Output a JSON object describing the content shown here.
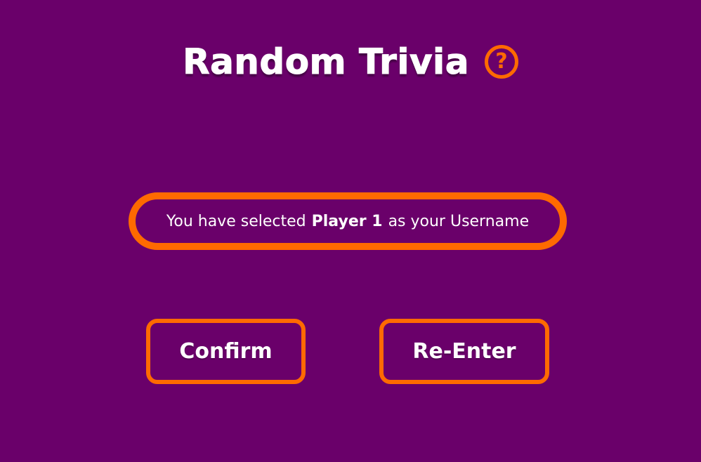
{
  "app": {
    "title": "Random Trivia"
  },
  "header": {
    "help_icon": "question-mark-circle-icon",
    "help_glyph": "?"
  },
  "message": {
    "prefix": "You have selected",
    "username": "Player 1",
    "suffix": "as your Username"
  },
  "actions": {
    "confirm_label": "Confirm",
    "reenter_label": "Re-Enter"
  },
  "colors": {
    "background": "#6a006a",
    "accent": "#ff6a00",
    "text": "#ffffff"
  }
}
